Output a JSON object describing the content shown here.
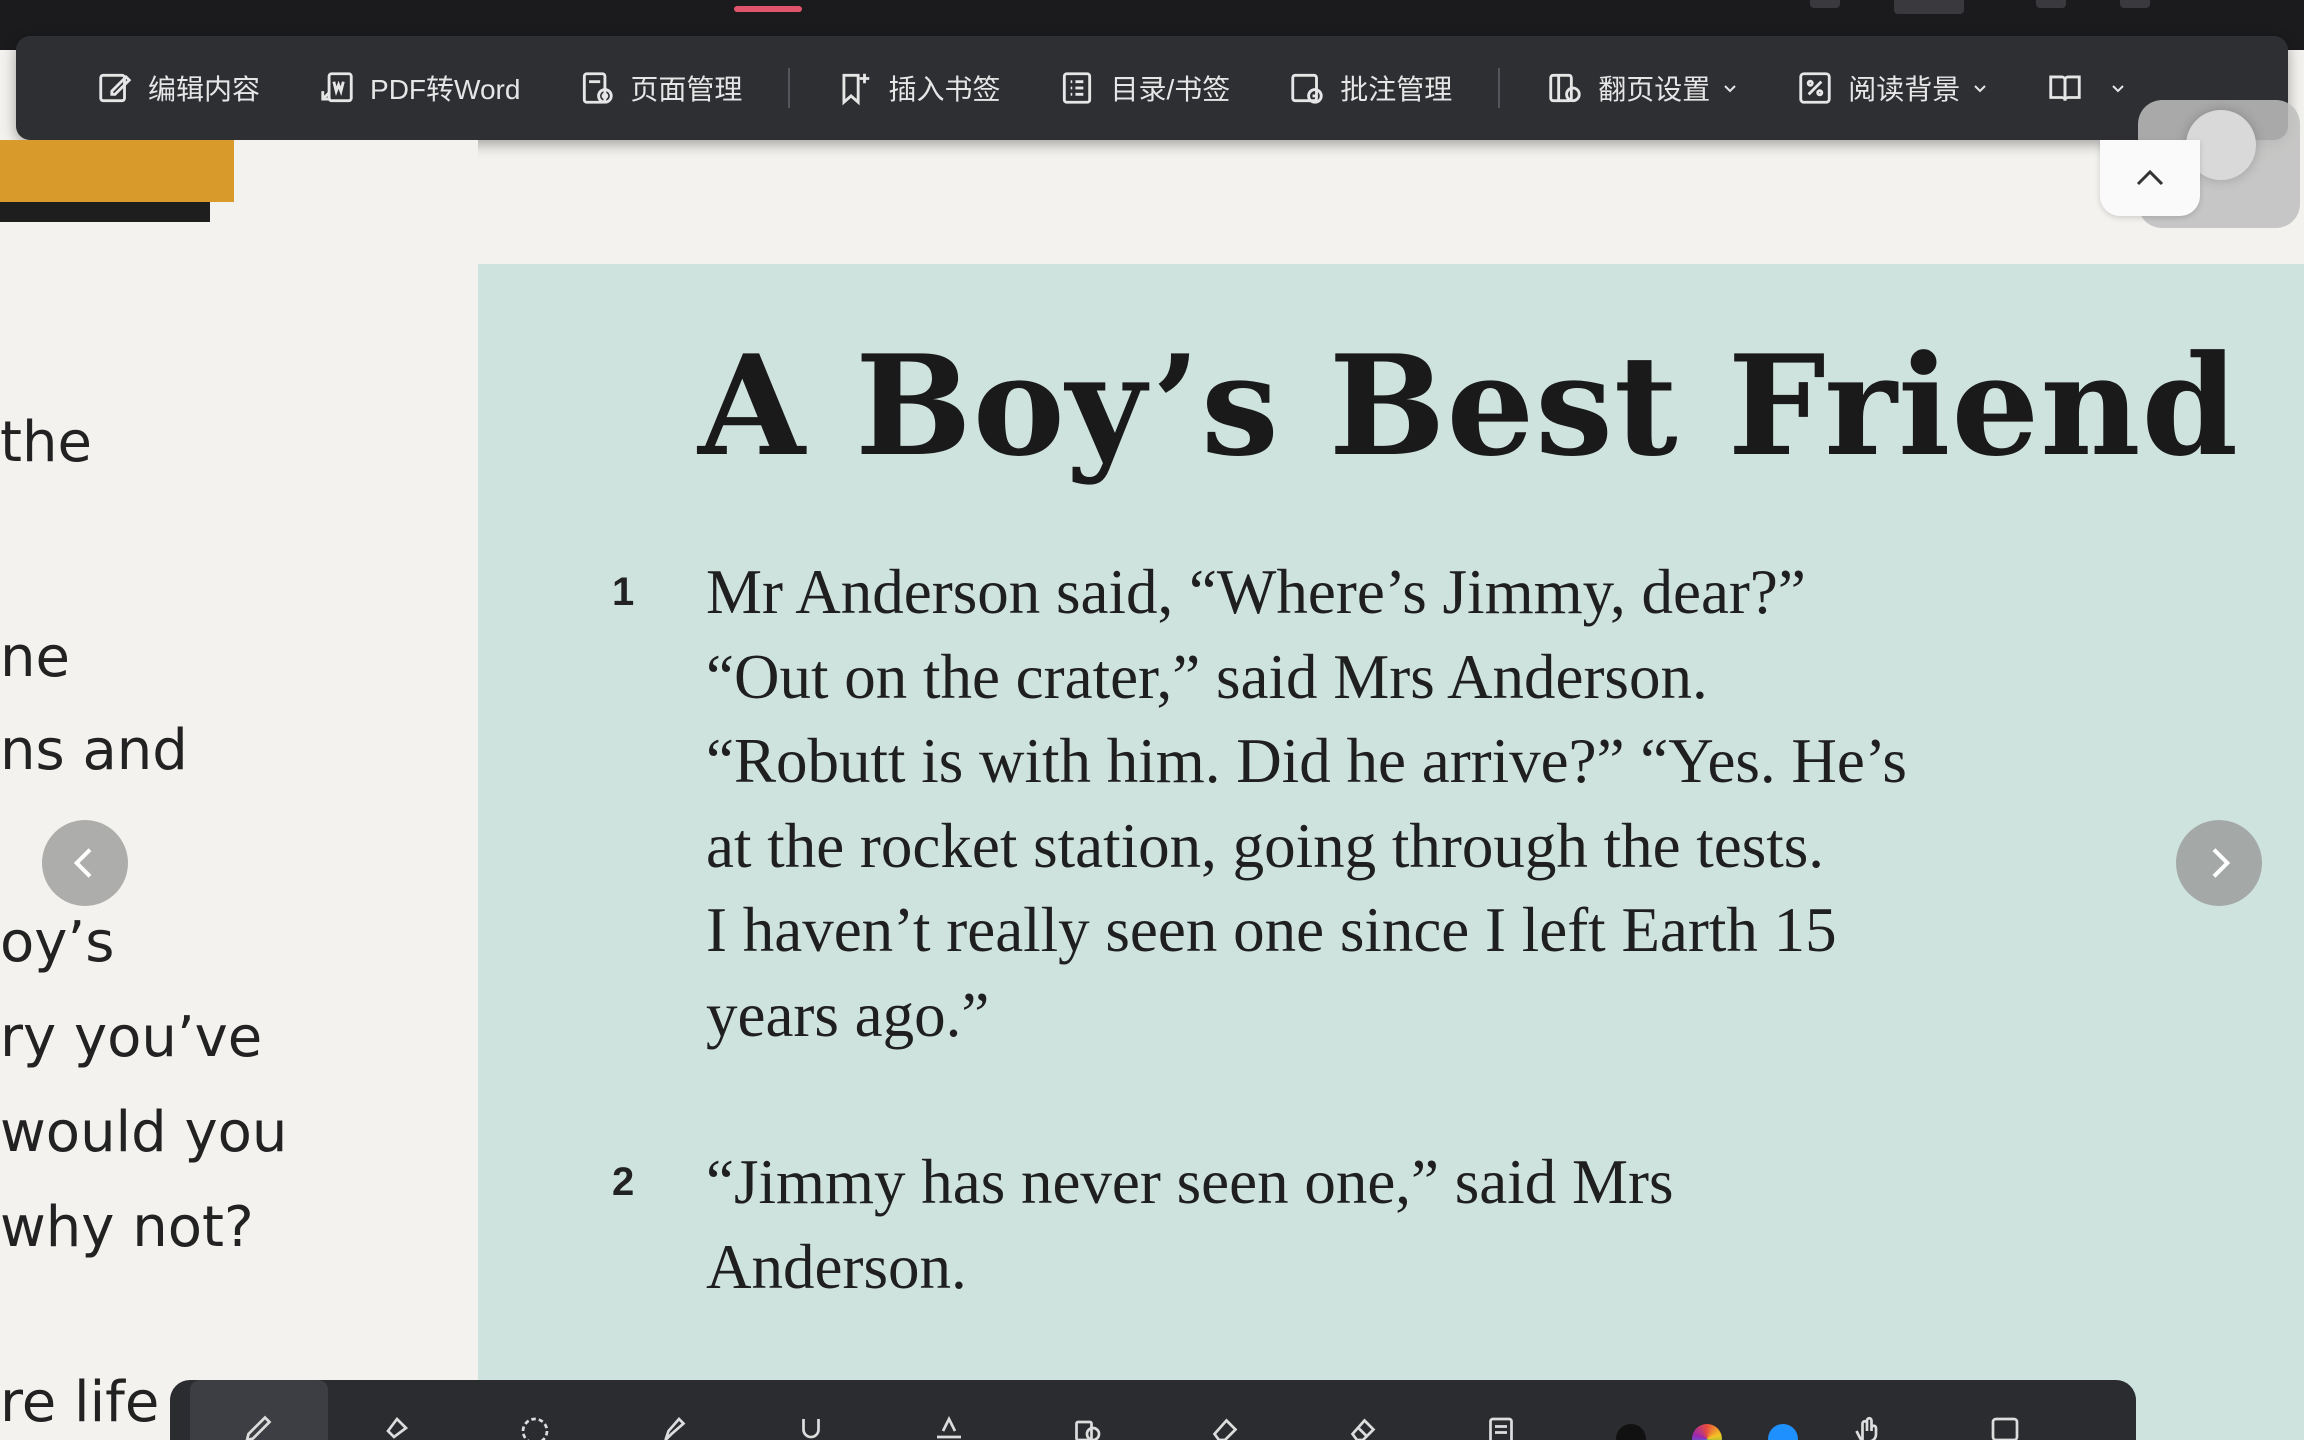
{
  "toolbar": {
    "items": [
      {
        "label": "编辑内容",
        "icon": "edit-icon"
      },
      {
        "label": "PDF转Word",
        "icon": "pdf-to-word-icon"
      },
      {
        "label": "页面管理",
        "icon": "page-manage-icon"
      },
      {
        "label": "插入书签",
        "icon": "insert-bookmark-icon"
      },
      {
        "label": "目录/书签",
        "icon": "toc-icon"
      },
      {
        "label": "批注管理",
        "icon": "annotation-manage-icon"
      },
      {
        "label": "翻页设置",
        "icon": "page-turn-icon"
      },
      {
        "label": "阅读背景",
        "icon": "reading-bg-icon"
      }
    ]
  },
  "left_page": {
    "lines": [
      "the",
      "ne",
      "ns and",
      "oy’s",
      "ry you’ve",
      "would you",
      "why not?",
      "re life"
    ]
  },
  "article": {
    "title": "A Boy’s Best Friend",
    "paragraphs": [
      {
        "number": "1",
        "lines": [
          "Mr Anderson said, “Where’s Jimmy, dear?”",
          "“Out on the crater,” said Mrs Anderson.",
          "“Robutt is with him. Did he arrive?” “Yes. He’s",
          "at the rocket station, going through the tests.",
          "I haven’t really seen one since I left Earth 15",
          "years ago.”"
        ]
      },
      {
        "number": "2",
        "lines": [
          "“Jimmy has never seen one,” said Mrs",
          "Anderson."
        ]
      }
    ]
  },
  "colors": {
    "toolbar_bg": "#2e2f33",
    "page_bg": "#cfe3de",
    "accent_orange": "#d99a2c",
    "active_tab": "#e0556b"
  },
  "annotation_tools": [
    "pen-icon",
    "highlighter-icon",
    "lasso-icon",
    "marker-icon",
    "underline-icon",
    "strikethrough-icon",
    "shape-icon",
    "eraser-icon",
    "eraser-all-icon",
    "note-icon",
    "hand-icon",
    "more-icon"
  ]
}
